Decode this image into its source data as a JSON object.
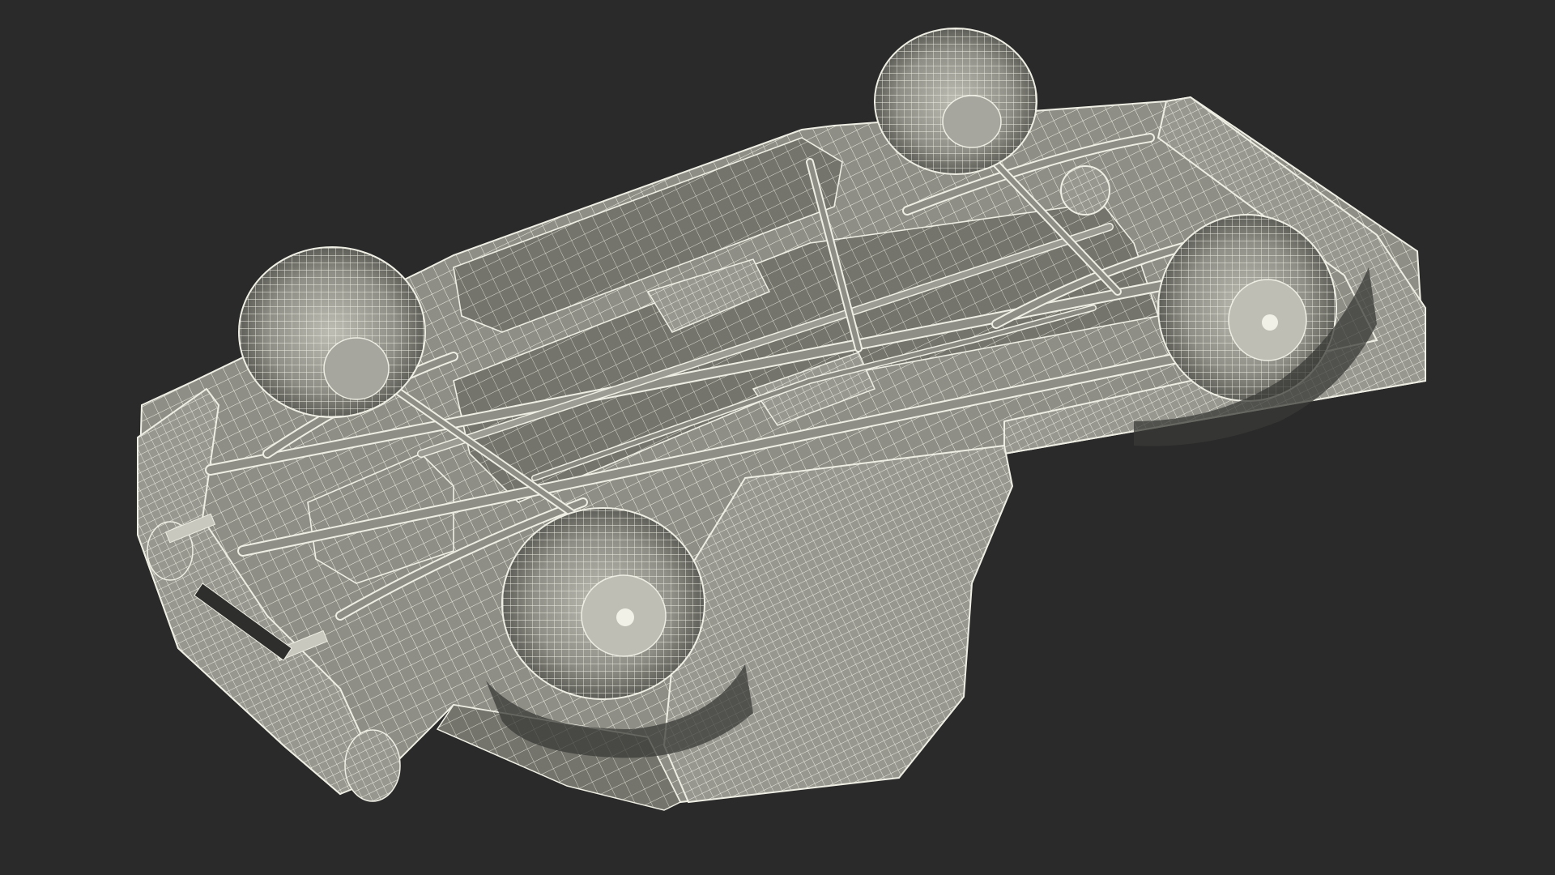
{
  "scene": {
    "background_color": "#2a2a2a",
    "model_fill_color": "#8e8e86",
    "wire_color": "#efeee4",
    "shadow_color": "#55554f",
    "view": "underside",
    "render_style": "wireframe-over-shaded"
  }
}
